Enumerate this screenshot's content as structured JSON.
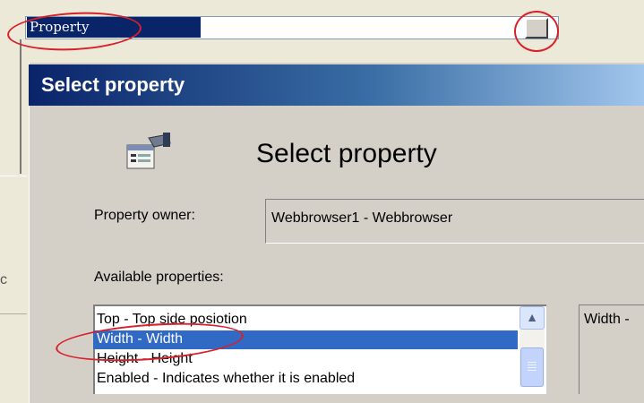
{
  "background": {
    "property_label": "Property"
  },
  "dialog": {
    "title": "Select property",
    "heading": "Select property",
    "owner_label": "Property owner:",
    "owner_value": "Webbrowser1 - Webbrowser",
    "available_label": "Available properties:",
    "properties": [
      {
        "label": "Top - Top side posiotion",
        "selected": false
      },
      {
        "label": "Width - Width",
        "selected": true
      },
      {
        "label": "Height - Height",
        "selected": false
      },
      {
        "label": "Enabled - Indicates whether it is enabled",
        "selected": false
      }
    ],
    "description_text": "Width -"
  },
  "icons": {
    "dialog_icon": "properties-icon",
    "scroll_up": "chevron-up-icon"
  },
  "colors": {
    "selection": "#316ac5",
    "annotation": "#d8202a",
    "titlebar": "#0a246a"
  }
}
